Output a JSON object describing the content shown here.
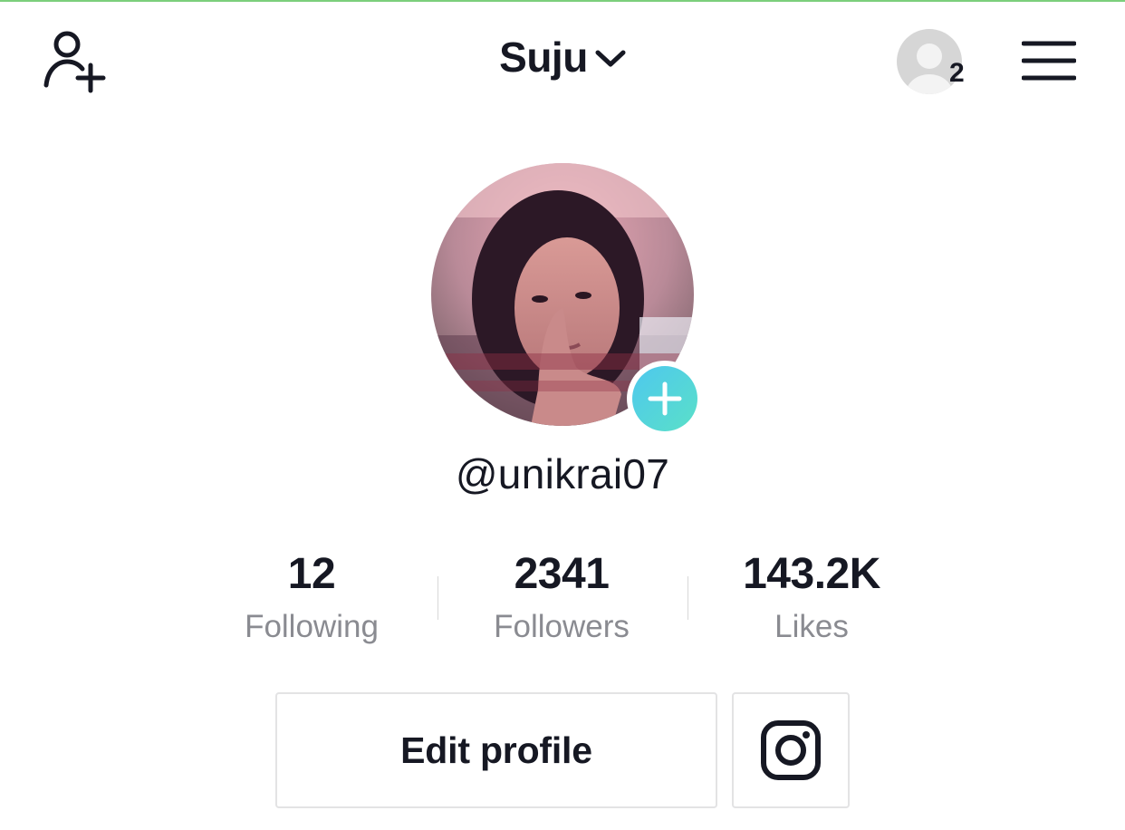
{
  "header": {
    "title": "Suju",
    "account_badge_count": "2"
  },
  "profile": {
    "username": "@unikrai07"
  },
  "stats": [
    {
      "value": "12",
      "label": "Following"
    },
    {
      "value": "2341",
      "label": "Followers"
    },
    {
      "value": "143.2K",
      "label": "Likes"
    }
  ],
  "actions": {
    "edit_profile_label": "Edit profile"
  },
  "icons": {
    "add_user": "person-plus-icon",
    "title_dropdown": "chevron-down-icon",
    "account": "default-avatar-icon",
    "menu": "hamburger-menu-icon",
    "add_photo": "plus-icon",
    "social": "instagram-icon"
  },
  "colors": {
    "text": "#161823",
    "muted": "#8a8b91",
    "accent_gradient_start": "#4ec8ee",
    "accent_gradient_end": "#5ae0c8",
    "border": "#e3e3e4"
  }
}
